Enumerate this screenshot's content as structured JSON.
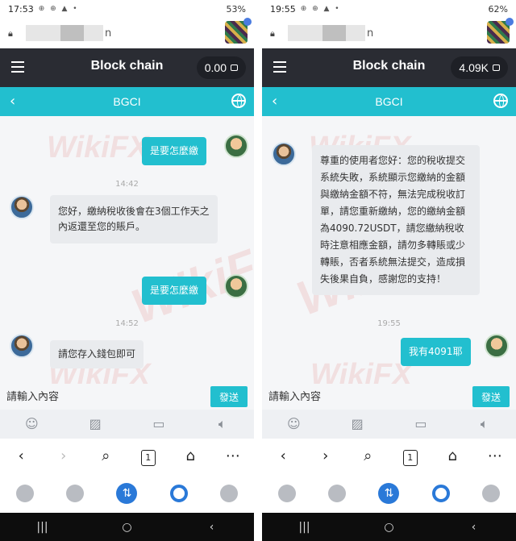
{
  "left": {
    "status": {
      "time": "17:53",
      "icons": "⊕ ⊕ ▲ •",
      "right": "53%"
    },
    "url_tail": "n",
    "app_title": "Block chain",
    "balance": "0.00",
    "chat_title": "BGCI",
    "messages": [
      {
        "dir": "out",
        "text": "是要怎麼繳"
      },
      {
        "dir": "time",
        "text": "14:42"
      },
      {
        "dir": "in",
        "text": "您好，繳納稅收後會在3個工作天之內返還至您的賬戶。"
      },
      {
        "dir": "out",
        "text": "是要怎麼繳"
      },
      {
        "dir": "time",
        "text": "14:52"
      },
      {
        "dir": "in",
        "text": "請您存入錢包即可"
      }
    ],
    "input_placeholder": "請輸入內容",
    "send_label": "發送"
  },
  "right": {
    "status": {
      "time": "19:55",
      "icons": "⊕ ⊕ ▲ •",
      "right": "62%"
    },
    "url_tail": "n",
    "app_title": "Block chain",
    "balance": "4.09K",
    "chat_title": "BGCI",
    "messages": [
      {
        "dir": "in",
        "text": "尊重的使用者您好：您的稅收提交系統失敗，系統顯示您繳納的金額與繳納金額不符，無法完成稅收訂單，請您重新繳納，您的繳納金額為4090.72USDT，請您繳納稅收時注意相應金額，請勿多轉賬或少轉賬，否者系統無法提交，造成損失後果自負，感謝您的支持！"
      },
      {
        "dir": "time",
        "text": "19:55"
      },
      {
        "dir": "out",
        "text": "我有4091耶"
      }
    ],
    "input_placeholder": "請輸入內容",
    "send_label": "發送"
  },
  "watermark": "WikiFX",
  "icons": {
    "tools": [
      "smile-icon",
      "image-icon",
      "folder-icon",
      "speaker-icon"
    ],
    "browser_nav": [
      "back-arrow-icon",
      "forward-arrow-icon",
      "search-icon",
      "tabs-icon",
      "home-icon",
      "more-icon"
    ],
    "dock": [
      "wallet-icon",
      "clock-icon",
      "swap-icon",
      "compass-icon",
      "settings-icon"
    ],
    "system_nav": [
      "recents-icon",
      "home-button-icon",
      "back-button-icon"
    ]
  },
  "tab_count": "1",
  "colors": {
    "accent": "#22bfcf",
    "appbar": "#2a2c33",
    "dock_active": "#2a79d8"
  }
}
